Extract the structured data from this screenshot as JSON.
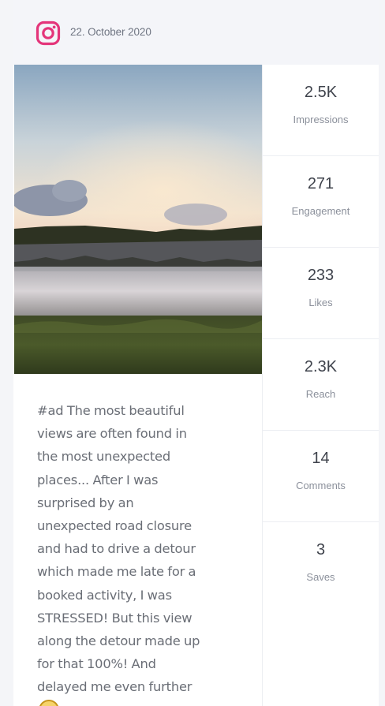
{
  "post": {
    "platform_icon": "instagram-icon",
    "date": "22. October 2020",
    "brand_color": "#e4357a",
    "caption_lines": [
      "#ad The most beautiful",
      "views are often found in",
      "the most unexpected",
      "places... After I was",
      "surprised by an",
      "unexpected road closure",
      "and had to drive a detour",
      "which made me late for a",
      "booked activity, I was",
      "STRESSED! But this view",
      "along the detour made up",
      "for that 100%! And",
      "delayed me even further"
    ]
  },
  "stats": [
    {
      "value": "2.5K",
      "label": "Impressions"
    },
    {
      "value": "271",
      "label": "Engagement"
    },
    {
      "value": "233",
      "label": "Likes"
    },
    {
      "value": "2.3K",
      "label": "Reach"
    },
    {
      "value": "14",
      "label": "Comments"
    },
    {
      "value": "3",
      "label": "Saves"
    }
  ]
}
